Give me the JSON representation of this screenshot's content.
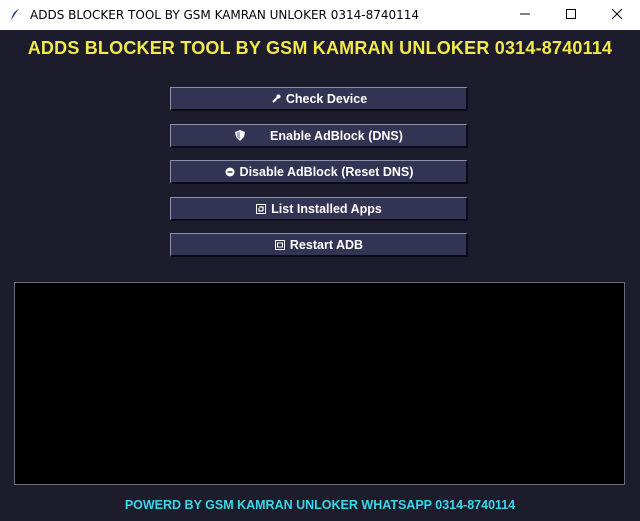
{
  "window": {
    "title": "ADDS BLOCKER TOOL BY GSM KAMRAN UNLOKER 0314-8740114",
    "app_icon": "feather-icon",
    "controls": [
      "minimize-icon",
      "maximize-icon",
      "close-icon"
    ]
  },
  "header": {
    "title": "ADDS BLOCKER TOOL BY GSM KAMRAN UNLOKER 0314-8740114",
    "color": "#f2e94e"
  },
  "buttons": [
    {
      "label": "Check Device",
      "icon": "wrench-icon"
    },
    {
      "label": "Enable AdBlock (DNS)",
      "icon": "shield-icon"
    },
    {
      "label": "Disable AdBlock (Reset DNS)",
      "icon": "reset-icon"
    },
    {
      "label": "List Installed Apps",
      "icon": "apps-icon"
    },
    {
      "label": "Restart ADB",
      "icon": "restart-icon"
    }
  ],
  "log": {
    "content": ""
  },
  "footer": {
    "text": "POWERD BY GSM KAMRAN UNLOKER WHATSAPP 0314-8740114",
    "color": "#3ad7e8"
  },
  "colors": {
    "background": "#1c1c2c",
    "button": "#333354",
    "log_background": "#000000"
  }
}
